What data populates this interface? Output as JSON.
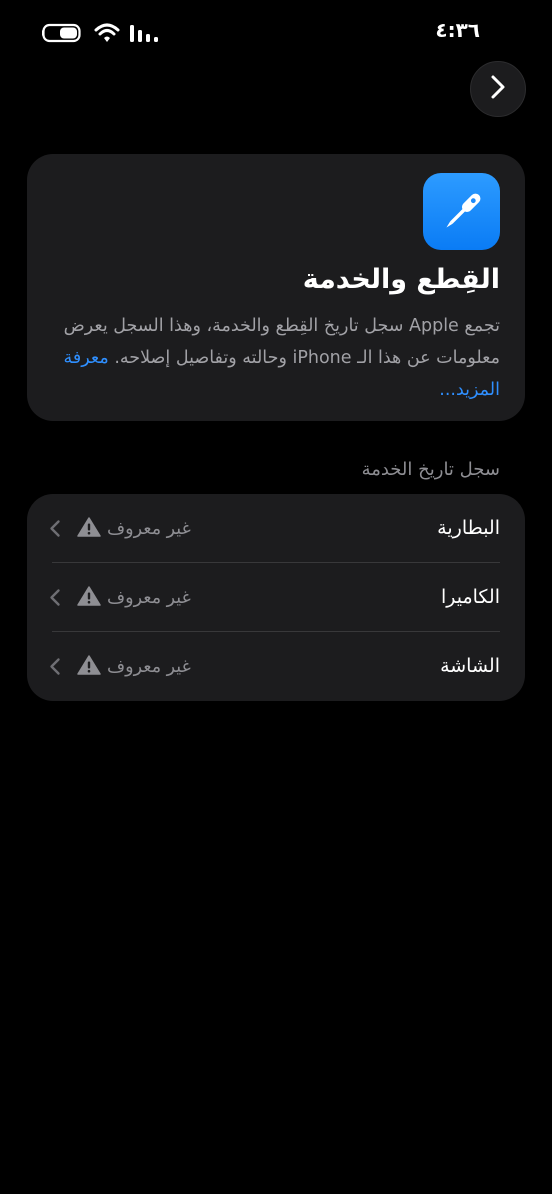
{
  "status_bar": {
    "time": "٤:٣٦",
    "icons": [
      "battery-icon",
      "wifi-icon",
      "cellular-signal-icon"
    ]
  },
  "navigation": {
    "forward_icon": "chevron-right-icon"
  },
  "info_card": {
    "icon": "screwdriver-icon",
    "icon_color": "#1e8bfa",
    "title": "القِطع والخدمة",
    "description": "تجمع Apple سجل تاريخ القِطع والخدمة، وهذا السجل يعرض معلومات عن هذا الـ iPhone وحالته وتفاصيل إصلاحه.",
    "learn_more": "معرفة المزيد..."
  },
  "service_history": {
    "header": "سجل تاريخ الخدمة",
    "items": [
      {
        "label": "البطارية",
        "status": "غير معروف",
        "status_icon": "warning-icon"
      },
      {
        "label": "الكاميرا",
        "status": "غير معروف",
        "status_icon": "warning-icon"
      },
      {
        "label": "الشاشة",
        "status": "غير معروف",
        "status_icon": "warning-icon"
      }
    ]
  },
  "colors": {
    "background": "#000000",
    "card": "#1c1c1e",
    "accent": "#2f8fff",
    "secondary_text": "#8e8e93"
  }
}
